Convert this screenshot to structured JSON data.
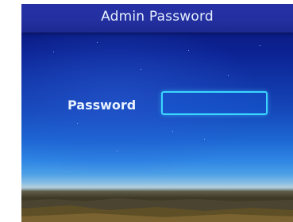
{
  "header": {
    "title": "Admin Password"
  },
  "form": {
    "password_label": "Password",
    "password_value": "",
    "password_placeholder": ""
  },
  "colors": {
    "title_bar": "#2430a0",
    "input_border": "#3ad6ff",
    "sky_top": "#0a1570",
    "sky_mid": "#1c66d2",
    "ground": "#4b4224"
  }
}
